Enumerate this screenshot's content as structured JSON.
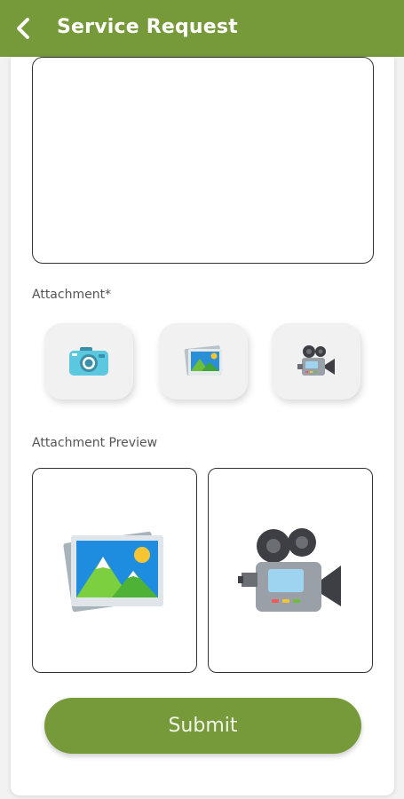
{
  "colors": {
    "accent": "#76993a",
    "header_text": "#ffffff"
  },
  "header": {
    "title": "Service Request",
    "back_icon": "chevron-left-icon"
  },
  "form": {
    "attachment_label": "Attachment*",
    "attachment_buttons": [
      {
        "icon": "camera-icon"
      },
      {
        "icon": "gallery-icon"
      },
      {
        "icon": "video-camera-icon"
      }
    ],
    "preview_label": "Attachment Preview",
    "previews": [
      {
        "icon": "image-preview-icon"
      },
      {
        "icon": "video-preview-icon"
      }
    ],
    "submit_label": "Submit"
  }
}
